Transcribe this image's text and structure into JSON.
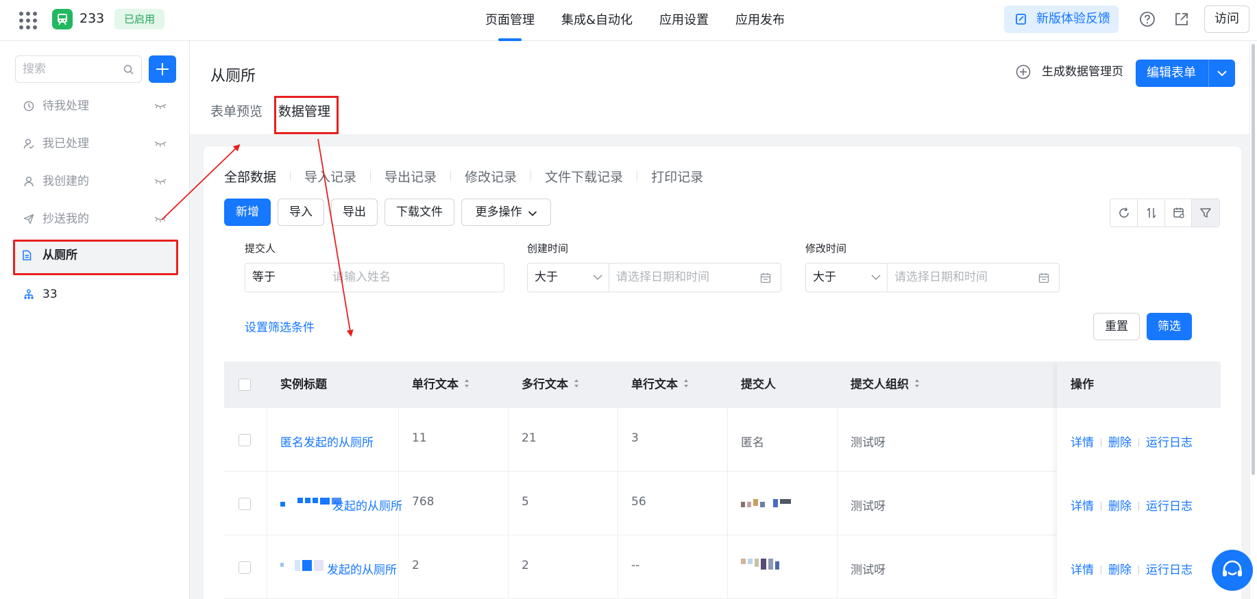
{
  "app": {
    "name": "233",
    "status": "已启用"
  },
  "topnav": {
    "tabs": [
      "页面管理",
      "集成&自动化",
      "应用设置",
      "应用发布"
    ],
    "feedback": "新版体验反馈",
    "visit": "访问"
  },
  "sidebar": {
    "search_placeholder": "搜索",
    "items": [
      {
        "label": "待我处理",
        "icon": "clock-icon"
      },
      {
        "label": "我已处理",
        "icon": "user-check-icon"
      },
      {
        "label": "我创建的",
        "icon": "user-icon"
      },
      {
        "label": "抄送我的",
        "icon": "send-icon"
      },
      {
        "label": "从厕所",
        "icon": "form-doc-icon"
      },
      {
        "label": "33",
        "icon": "org-tree-icon"
      }
    ]
  },
  "form": {
    "title": "从厕所",
    "subtabs": [
      "表单预览",
      "数据管理"
    ],
    "generate_page": "生成数据管理页",
    "edit_form": "编辑表单"
  },
  "data_tabs": [
    "全部数据",
    "导入记录",
    "导出记录",
    "修改记录",
    "文件下载记录",
    "打印记录"
  ],
  "toolbar": {
    "add": "新增",
    "import": "导入",
    "export": "导出",
    "download": "下载文件",
    "more": "更多操作"
  },
  "filters": {
    "submitter": {
      "label": "提交人",
      "op": "等于",
      "placeholder": "请输入姓名"
    },
    "created": {
      "label": "创建时间",
      "op": "大于",
      "placeholder": "请选择日期和时间"
    },
    "modified": {
      "label": "修改时间",
      "op": "大于",
      "placeholder": "请选择日期和时间"
    },
    "set_conditions": "设置筛选条件",
    "reset": "重置",
    "apply": "筛选"
  },
  "table": {
    "headers": [
      "实例标题",
      "单行文本",
      "多行文本",
      "单行文本",
      "提交人",
      "提交人组织",
      "操作"
    ],
    "rows": [
      {
        "title": "匿名发起的从厕所",
        "c1": "11",
        "c2": "21",
        "c3": "3",
        "submitter": "匿名",
        "org": "测试呀"
      },
      {
        "title": "发起的从厕所",
        "c1": "768",
        "c2": "5",
        "c3": "56",
        "submitter": "",
        "org": "测试呀"
      },
      {
        "title": "发起的从厕所",
        "c1": "2",
        "c2": "2",
        "c3": "--",
        "submitter": "",
        "org": "测试呀"
      }
    ],
    "actions": [
      "详情",
      "删除",
      "运行日志"
    ]
  },
  "colors": {
    "primary": "#1677ff",
    "annotation": "#e81f1f",
    "enabled_bg": "#e3f7ea",
    "enabled_text": "#22a55a"
  }
}
